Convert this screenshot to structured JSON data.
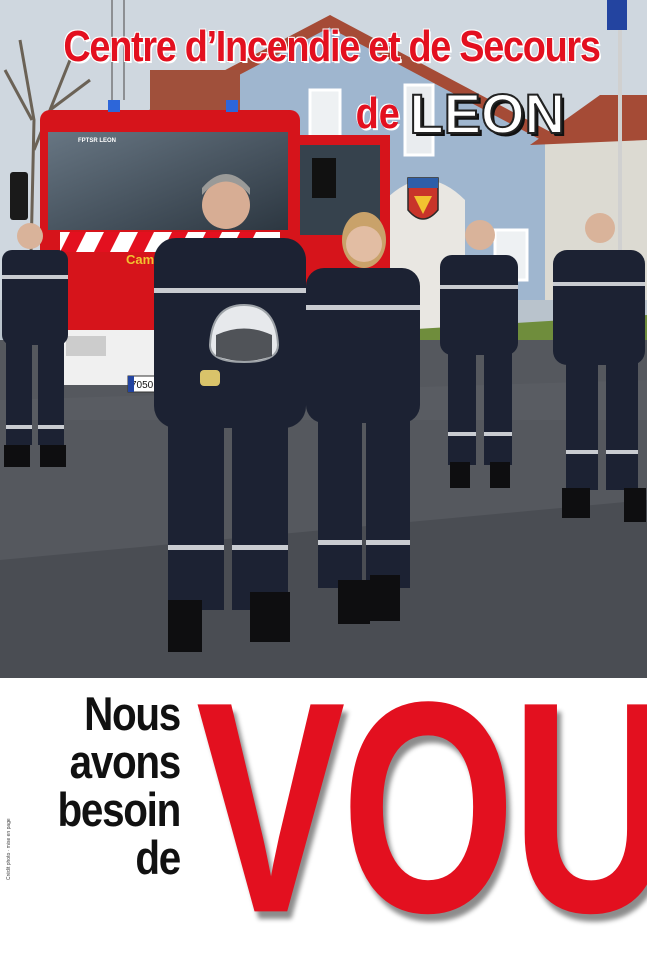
{
  "poster": {
    "title_line1": "Centre d’Incendie et de Secours",
    "title_de": "de",
    "title_leon": "LEON",
    "slogan": [
      "Nous",
      "avons",
      "besoin",
      "de"
    ],
    "big_word": "VOUS",
    "truck_cab_label": "FPTSR LEON",
    "truck_side_text": "Camiva",
    "license_plate": "7050 0",
    "credit_text": "Crédit photo · mise en page"
  },
  "colors": {
    "accent_red": "#e3101f",
    "uniform_navy": "#1c2233",
    "text_dark": "#111111"
  }
}
